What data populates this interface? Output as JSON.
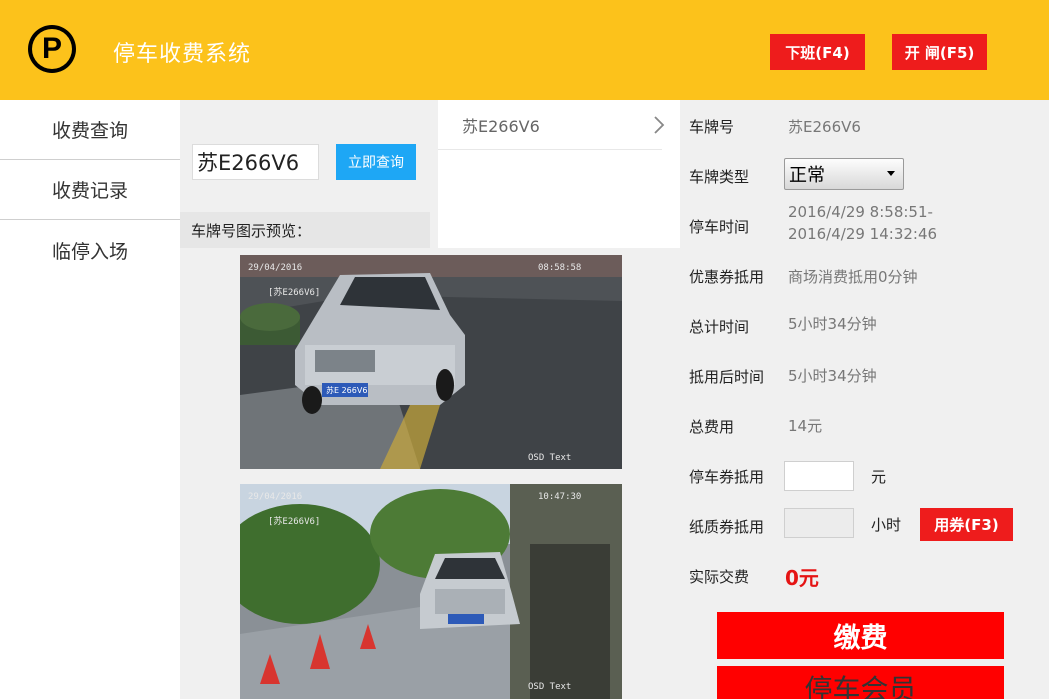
{
  "header": {
    "logo_letter": "P",
    "title": "停车收费系统",
    "off_duty_label": "下班(F4)",
    "open_gate_label": "开 闸(F5)"
  },
  "nav": {
    "items": [
      {
        "label": "收费查询"
      },
      {
        "label": "收费记录"
      },
      {
        "label": "临停入场"
      }
    ]
  },
  "search": {
    "plate_value": "苏E266V6",
    "query_label": "立即查询",
    "preview_label": "车牌号图示预览："
  },
  "results": {
    "items": [
      {
        "plate": "苏E266V6"
      }
    ]
  },
  "cameras": [
    {
      "date": "29/04/2016",
      "time": "08:58:58",
      "plate_tag": "[苏E266V6]",
      "plate": "苏E 266V6",
      "footer": "OSD   Text"
    },
    {
      "date": "29/04/2016",
      "time": "10:47:30",
      "plate_tag": "[苏E266V6]",
      "plate": "苏E266V6",
      "footer": "OSD   Text"
    }
  ],
  "info": {
    "plate_label": "车牌号",
    "plate_value": "苏E266V6",
    "type_label": "车牌类型",
    "type_value": "正常",
    "time_label": "停车时间",
    "time_value_1": "2016/4/29 8:58:51-",
    "time_value_2": "2016/4/29 14:32:46",
    "discount_label": "优惠券抵用",
    "discount_value": "商场消费抵用0分钟",
    "total_time_label": "总计时间",
    "total_time_value": "5小时34分钟",
    "after_label": "抵用后时间",
    "after_value": "5小时34分钟",
    "fee_label": "总费用",
    "fee_value": "14元",
    "ticket_label": "停车券抵用",
    "ticket_unit": "元",
    "paper_label": "纸质券抵用",
    "paper_unit": "小时",
    "coupon_button": "用券(F3)",
    "actual_label": "实际交费",
    "actual_value": "0元",
    "pay_button": "缴费",
    "member_button": "停车会员"
  },
  "colors": {
    "header": "#fcc21b",
    "accent_red": "#ee1c1c",
    "query_blue": "#1ea7f5"
  }
}
